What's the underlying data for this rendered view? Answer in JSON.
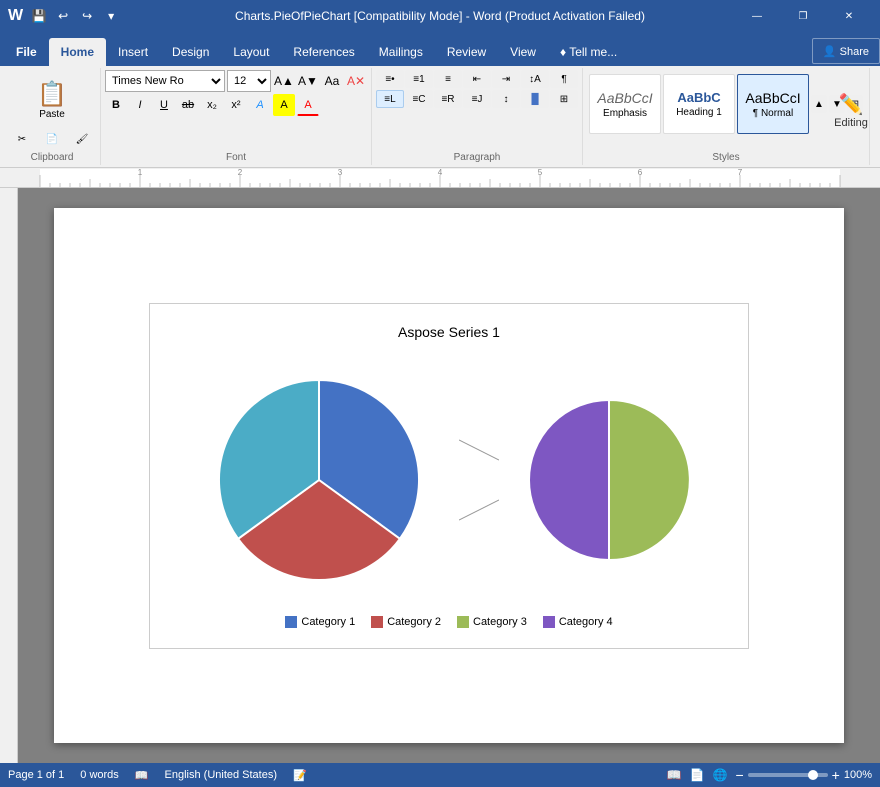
{
  "titlebar": {
    "title": "Charts.PieOfPieChart [Compatibility Mode] - Word (Product Activation Failed)",
    "save_icon": "💾",
    "undo_icon": "↩",
    "redo_icon": "↪",
    "customize_icon": "▾",
    "minimize_icon": "—",
    "restore_icon": "❐",
    "close_icon": "✕"
  },
  "tabs": [
    {
      "label": "File",
      "active": false
    },
    {
      "label": "Home",
      "active": true
    },
    {
      "label": "Insert",
      "active": false
    },
    {
      "label": "Design",
      "active": false
    },
    {
      "label": "Layout",
      "active": false
    },
    {
      "label": "References",
      "active": false
    },
    {
      "label": "Mailings",
      "active": false
    },
    {
      "label": "Review",
      "active": false
    },
    {
      "label": "View",
      "active": false
    },
    {
      "label": "♦ Tell me...",
      "active": false
    }
  ],
  "ribbon": {
    "clipboard_label": "Clipboard",
    "font_label": "Font",
    "paragraph_label": "Paragraph",
    "styles_label": "Styles",
    "font_name": "Times New Ro",
    "font_size": "12",
    "paste_label": "Paste",
    "share_label": "Share",
    "editing_label": "Editing"
  },
  "styles": [
    {
      "name": "Emphasis",
      "preview": "AaBbCcI",
      "class": "emphasis"
    },
    {
      "name": "Heading 1",
      "preview": "AaBbC",
      "class": "heading1"
    },
    {
      "name": "Normal",
      "preview": "AaBbCcI",
      "class": "normal",
      "active": true
    }
  ],
  "chart": {
    "title": "Aspose Series 1",
    "categories": [
      {
        "label": "Category 1",
        "color": "#4472c4",
        "value": 35
      },
      {
        "label": "Category 2",
        "color": "#c0504d",
        "value": 25
      },
      {
        "label": "Category 3",
        "color": "#4bacc6",
        "value": 22
      },
      {
        "label": "Category 4",
        "color": "#7e57c2",
        "value": 18
      }
    ],
    "main_pie": {
      "segments": [
        {
          "label": "Category 1",
          "color": "#4472c4",
          "startAngle": 0,
          "endAngle": 144
        },
        {
          "label": "Category 2",
          "color": "#c0504d",
          "startAngle": 144,
          "endAngle": 246
        },
        {
          "label": "Category 3",
          "color": "#4bacc6",
          "startAngle": 246,
          "endAngle": 360
        }
      ]
    },
    "small_pie": {
      "segments": [
        {
          "label": "Category 3",
          "color": "#9cbb58",
          "startAngle": 0,
          "endAngle": 180
        },
        {
          "label": "Category 4",
          "color": "#7e57c2",
          "startAngle": 180,
          "endAngle": 360
        }
      ]
    }
  },
  "statusbar": {
    "page_info": "Page 1 of 1",
    "words": "0 words",
    "language": "English (United States)",
    "zoom": "100%",
    "zoom_minus": "−",
    "zoom_plus": "+"
  }
}
